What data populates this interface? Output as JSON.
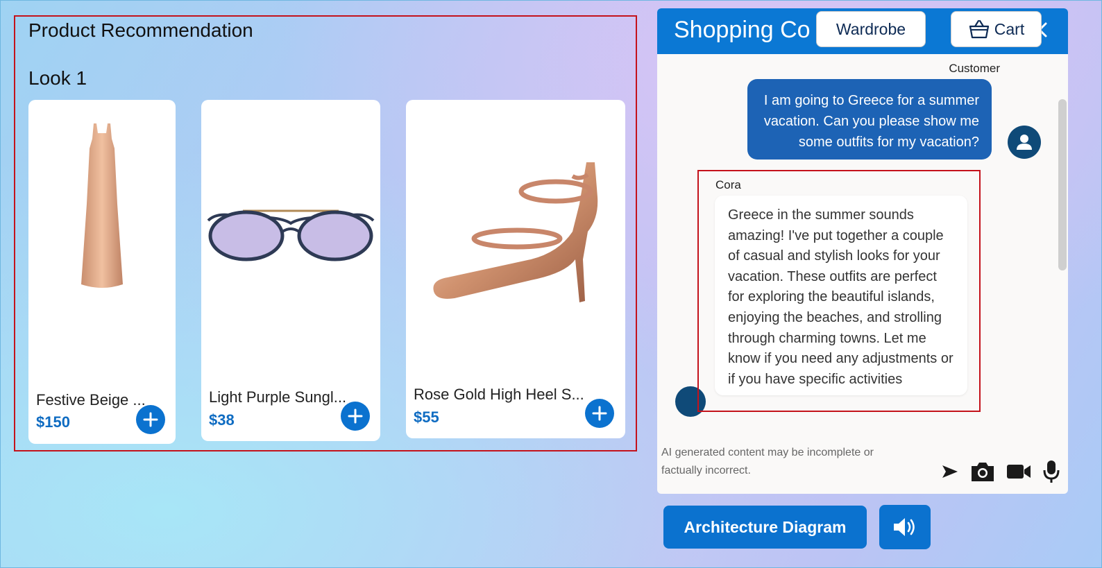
{
  "recommendation": {
    "title": "Product Recommendation",
    "look_title": "Look 1",
    "products": [
      {
        "name": "Festive Beige ...",
        "price": "$150",
        "image": "beige-dress-image"
      },
      {
        "name": "Light Purple Sungl...",
        "price": "$38",
        "image": "purple-sunglasses-image"
      },
      {
        "name": "Rose Gold High Heel S...",
        "price": "$55",
        "image": "rose-gold-heel-image"
      }
    ]
  },
  "chat": {
    "title": "Shopping Co",
    "wardrobe_label": "Wardrobe",
    "cart_label": "Cart",
    "customer_label": "Customer",
    "customer_message_lines": [
      "I am going to Greece for a summer",
      "vacation. Can you please show me",
      "some outfits for my vacation?"
    ],
    "assistant_label": "Cora",
    "assistant_message": "Greece in the summer sounds amazing! I've put together a couple of casual and stylish looks for your vacation. These outfits are perfect for exploring the beautiful islands, enjoying the beaches, and strolling through charming towns. Let me know if you need any adjustments or if you have specific activities",
    "disclaimer": "AI generated content may be incomplete or factually incorrect.",
    "icons": [
      "send-icon",
      "camera-icon",
      "video-icon",
      "microphone-icon"
    ]
  },
  "footer": {
    "architecture_label": "Architecture Diagram",
    "speaker_icon": "speaker-icon"
  },
  "colors": {
    "accent": "#0b72cf",
    "header": "#0b78d4",
    "user_bubble": "#1d63b5",
    "price": "#0f6cc2",
    "highlight": "#c4121b"
  }
}
